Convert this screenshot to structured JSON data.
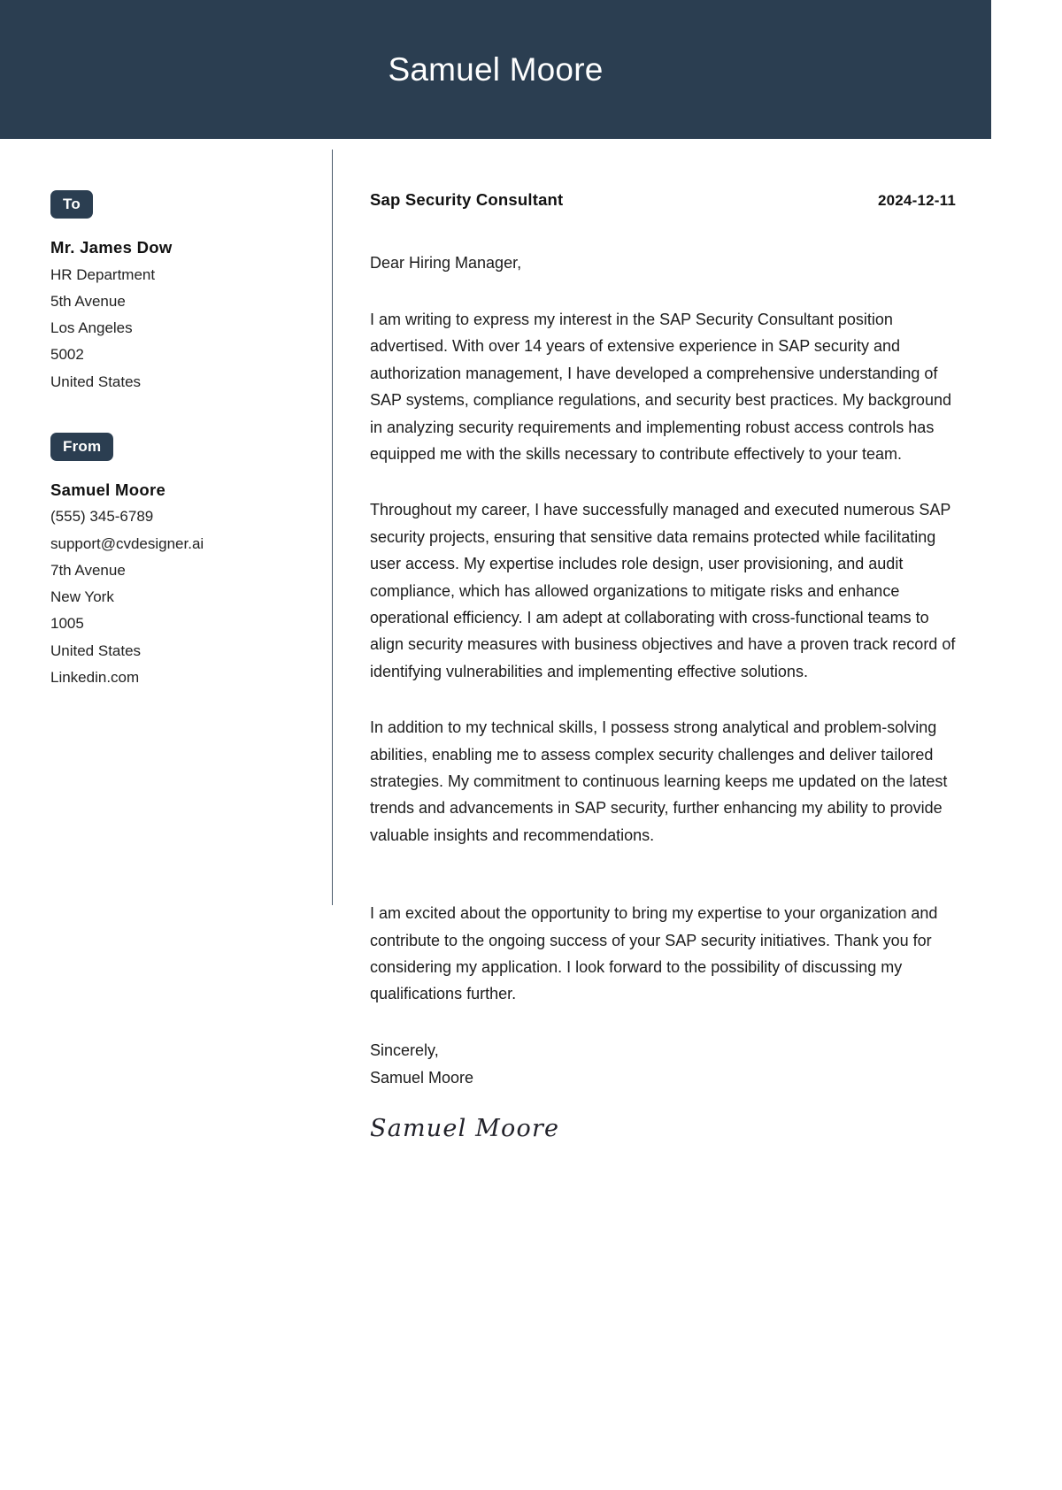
{
  "header": {
    "name": "Samuel Moore",
    "background_color": "#2b3e51",
    "text_color": "#ffffff"
  },
  "sidebar": {
    "to": {
      "badge_label": "To",
      "recipient_name": "Mr. James Dow",
      "lines": [
        "HR Department",
        "5th Avenue",
        "Los Angeles",
        "5002",
        "United States"
      ]
    },
    "from": {
      "badge_label": "From",
      "sender_name": "Samuel Moore",
      "lines": [
        "(555) 345-6789",
        "support@cvdesigner.ai",
        "7th Avenue",
        "New York",
        "1005",
        "United States",
        "Linkedin.com"
      ]
    }
  },
  "letter": {
    "job_title": "Sap Security Consultant",
    "date": "2024-12-11",
    "salutation": "Dear Hiring Manager,",
    "paragraphs": [
      "I am writing to express my interest in the SAP Security Consultant position advertised. With over 14 years of extensive experience in SAP security and authorization management, I have developed a comprehensive understanding of SAP systems, compliance regulations, and security best practices. My background in analyzing security requirements and implementing robust access controls has equipped me with the skills necessary to contribute effectively to your team.",
      "Throughout my career, I have successfully managed and executed numerous SAP security projects, ensuring that sensitive data remains protected while facilitating user access. My expertise includes role design, user provisioning, and audit compliance, which has allowed organizations to mitigate risks and enhance operational efficiency. I am adept at collaborating with cross-functional teams to align security measures with business objectives and have a proven track record of identifying vulnerabilities and implementing effective solutions.",
      "In addition to my technical skills, I possess strong analytical and problem-solving abilities, enabling me to assess complex security challenges and deliver tailored strategies. My commitment to continuous learning keeps me updated on the latest trends and advancements in SAP security, further enhancing my ability to provide valuable insights and recommendations.",
      "I am excited about the opportunity to bring my expertise to your organization and contribute to the ongoing success of your SAP security initiatives. Thank you for considering my application. I look forward to the possibility of discussing my qualifications further."
    ],
    "closing_word": "Sincerely,",
    "closing_name": "Samuel Moore",
    "signature": "Samuel Moore"
  }
}
